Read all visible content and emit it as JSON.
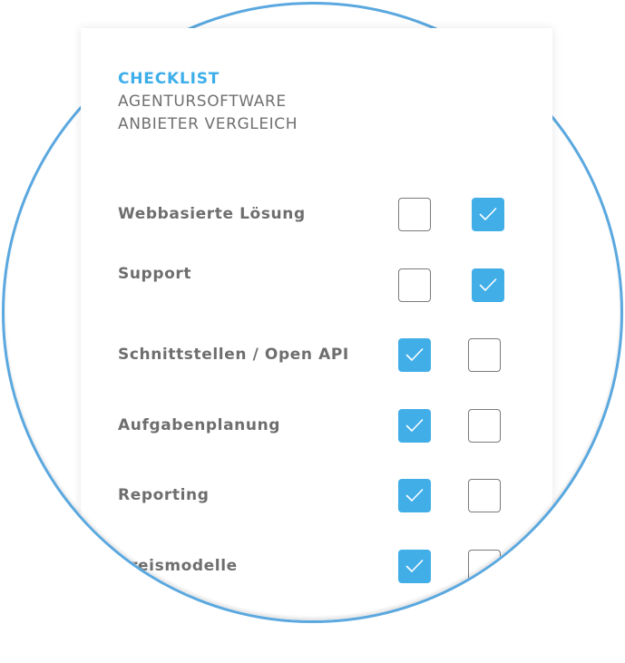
{
  "header": {
    "kicker": "CHECKLIST",
    "line1": "AGENTURSOFTWARE",
    "line2": "ANBIETER VERGLEICH"
  },
  "colors": {
    "accent": "#3daee9",
    "checkbox_checked": "#41aee8",
    "circle_stroke": "#5aa8df",
    "label_text": "#6e6e6e"
  },
  "rows": [
    {
      "label": "Webbasierte Lösung",
      "col1_checked": false,
      "col2_checked": true
    },
    {
      "label": "Support",
      "col1_checked": false,
      "col2_checked": true
    },
    {
      "label": "Schnittstellen / Open API",
      "col1_checked": true,
      "col2_checked": false
    },
    {
      "label": "Aufgabenplanung",
      "col1_checked": true,
      "col2_checked": false
    },
    {
      "label": "Reporting",
      "col1_checked": true,
      "col2_checked": false
    },
    {
      "label": "Preismodelle",
      "col1_checked": true,
      "col2_checked": false
    }
  ],
  "icons": {
    "checked": "checkmark-icon"
  }
}
